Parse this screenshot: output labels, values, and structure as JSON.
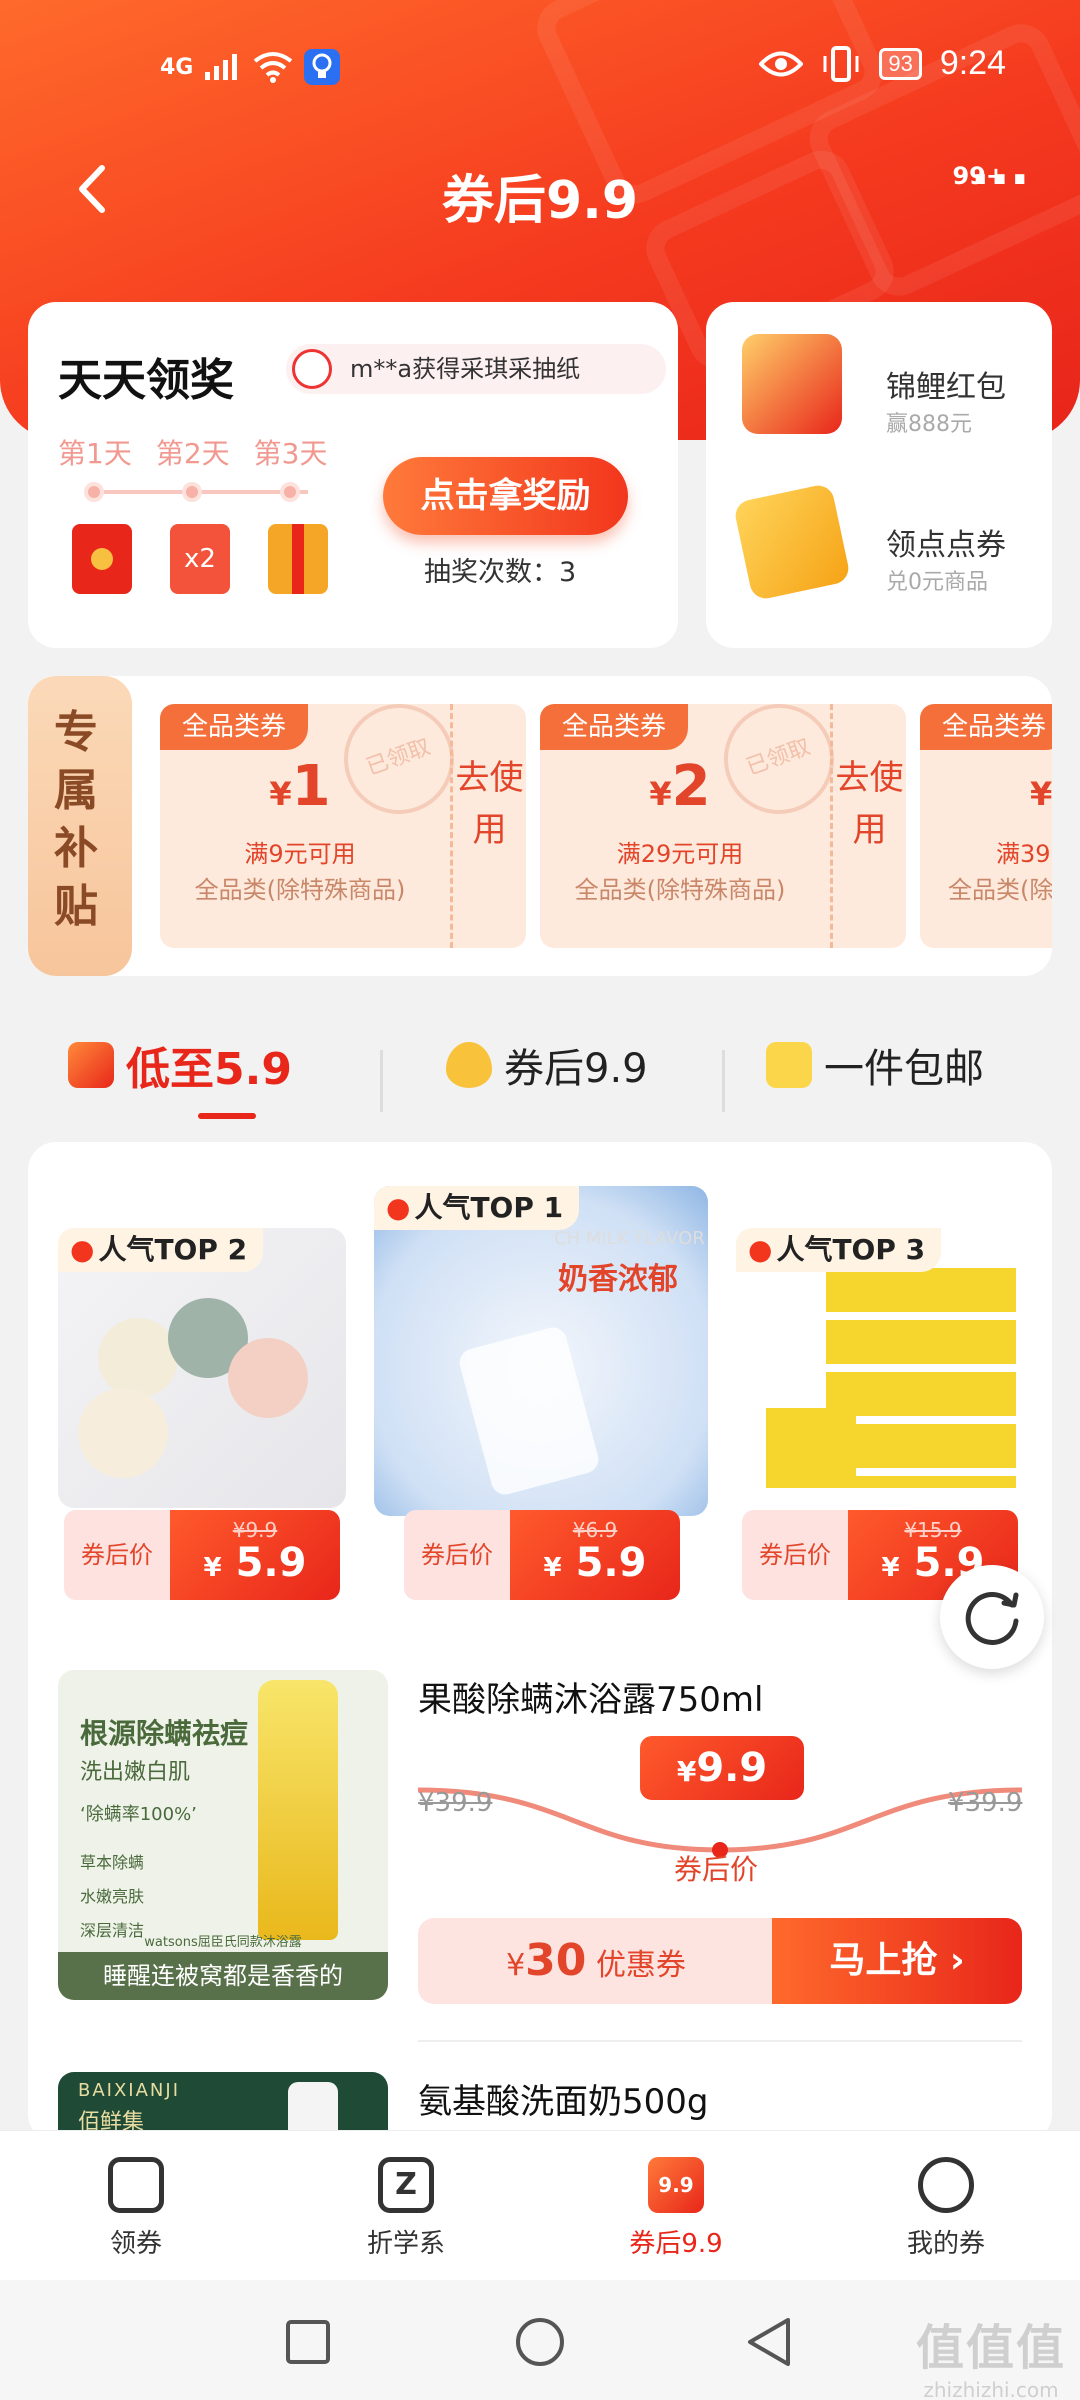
{
  "status_bar": {
    "network": "4G",
    "battery": "93",
    "time": "9:24"
  },
  "header": {
    "title": "券后9.9",
    "more_badge": "99+"
  },
  "daily_reward": {
    "title": "天天领奖",
    "ticker": "m**a获得采琪采抽纸",
    "days": [
      "第1天",
      "第2天",
      "第3天"
    ],
    "multiplier": "x2",
    "claim_button": "点击拿奖励",
    "draws_text": "抽奖次数：3"
  },
  "side_cards": [
    {
      "title": "锦鲤红包",
      "subtitle": "赢888元"
    },
    {
      "title": "领点点券",
      "subtitle": "兑0元商品"
    }
  ],
  "subsidy": {
    "label": "专属补贴",
    "coupons": [
      {
        "tag": "全品类券",
        "currency": "¥",
        "amount": "1",
        "condition": "满9元可用",
        "scope": "全品类(除特殊商品)",
        "action": "去使用",
        "stamp": "已领取"
      },
      {
        "tag": "全品类券",
        "currency": "¥",
        "amount": "2",
        "condition": "满29元可用",
        "scope": "全品类(除特殊商品)",
        "action": "去使用",
        "stamp": "已领取"
      },
      {
        "tag": "全品类券",
        "currency": "¥",
        "amount": "",
        "condition": "满39",
        "scope": "全品类(除",
        "action": "",
        "stamp": ""
      }
    ]
  },
  "tabs": [
    {
      "label": "低至5.9",
      "icon": "flash-cart-icon",
      "active": true
    },
    {
      "label": "券后9.9",
      "icon": "flame-icon",
      "active": false
    },
    {
      "label": "一件包邮",
      "icon": "star-flag-icon",
      "active": false
    }
  ],
  "top_products": [
    {
      "badge": "人气TOP 2",
      "price_label": "券后价",
      "orig": "¥9.9",
      "currency": "¥",
      "price": "5.9"
    },
    {
      "badge": "人气TOP 1",
      "price_label": "券后价",
      "orig": "¥6.9",
      "currency": "¥",
      "price": "5.9",
      "img_text": "奶香浓郁",
      "img_text_en": "CH MILK FLAVOR"
    },
    {
      "badge": "人气TOP 3",
      "price_label": "券后价",
      "orig": "¥15.9",
      "currency": "¥",
      "price": "5.9"
    }
  ],
  "product_rows": [
    {
      "name": "果酸除螨沐浴露750ml",
      "orig_left": "¥39.9",
      "orig_right": "¥39.9",
      "currency": "¥",
      "price": "9.9",
      "after_label": "券后价",
      "coupon_currency": "¥",
      "coupon_amount": "30",
      "coupon_label": "优惠券",
      "buy_label": "马上抢 ›",
      "img_title": "根源除螨祛痘",
      "img_sub": "洗出嫩白肌",
      "img_quote": "‘除螨率100%’",
      "img_points": [
        "草本除螨",
        "水嫩亮肤",
        "深层清洁"
      ],
      "img_footnote": "watsons屈臣氏同款沐浴露",
      "img_caption": "睡醒连被窝都是香香的"
    },
    {
      "name": "氨基酸洗面奶500g",
      "img_brand": "BAIXIANJI",
      "img_brand_cn": "佰鲜集"
    }
  ],
  "bottom_nav": [
    {
      "label": "领券",
      "icon": "coupon-icon",
      "active": false
    },
    {
      "label": "折学系",
      "icon": "z-icon",
      "active": false
    },
    {
      "label": "券后9.9",
      "icon": "nine-nine-icon",
      "icon_text": "9.9",
      "active": true
    },
    {
      "label": "我的券",
      "icon": "smile-icon",
      "active": false
    }
  ],
  "watermark": {
    "chars": "值值值",
    "url": "zhizhizhi.com"
  },
  "colors": {
    "accent": "#e8261a",
    "hero": "#f53a1f",
    "coupon_bg": "#feeadc"
  }
}
